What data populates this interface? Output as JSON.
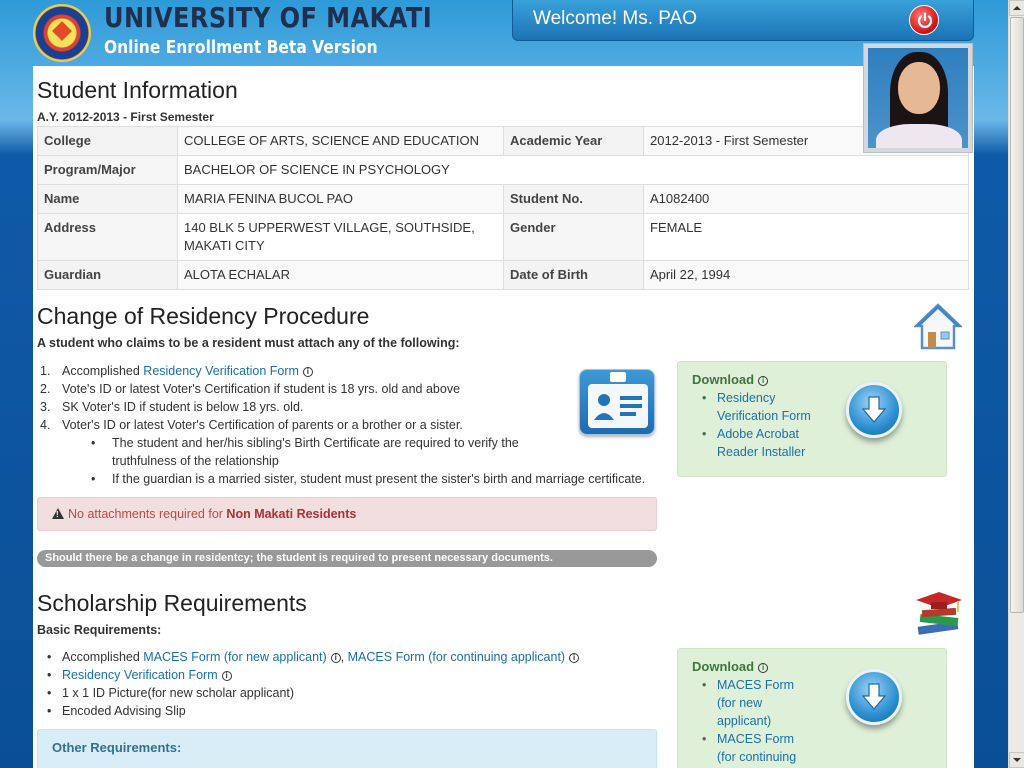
{
  "header": {
    "university": "UNIVERSITY OF MAKATI",
    "subtitle": "Online Enrollment Beta Version",
    "welcome": "Welcome! Ms. PAO"
  },
  "student_info": {
    "title": "Student Information",
    "term": "A.Y. 2012-2013 - First Semester",
    "rows": [
      {
        "l1": "College",
        "v1": "COLLEGE OF ARTS, SCIENCE AND EDUCATION",
        "l2": "Academic Year",
        "v2": "2012-2013 - First Semester"
      },
      {
        "l1": "Program/Major",
        "v1": "BACHELOR OF SCIENCE IN PSYCHOLOGY"
      },
      {
        "l1": "Name",
        "v1": "MARIA FENINA BUCOL PAO",
        "l2": "Student No.",
        "v2": "A1082400"
      },
      {
        "l1": "Address",
        "v1": "140 BLK 5 UPPERWEST VILLAGE, SOUTHSIDE, MAKATI CITY",
        "l2": "Gender",
        "v2": "FEMALE"
      },
      {
        "l1": "Guardian",
        "v1": "ALOTA ECHALAR",
        "l2": "Date of Birth",
        "v2": "April 22, 1994"
      }
    ]
  },
  "residency": {
    "title": "Change of Residency Procedure",
    "intro": "A student who claims to be a resident must attach any of the following:",
    "steps": [
      {
        "num": "1.",
        "text": "Accomplished ",
        "link": "Residency Verification Form"
      },
      {
        "num": "2.",
        "text": "Vote's ID or latest Voter's Certification if student is 18 yrs. old and above"
      },
      {
        "num": "3.",
        "text": "SK Voter's ID if student is below 18 yrs. old."
      },
      {
        "num": "4.",
        "text": "Voter's ID or latest Voter's Certification of parents or a brother or a sister."
      }
    ],
    "sub_steps": [
      "The student and her/his sibling's Birth Certificate are required to verify the truthfulness of the relationship",
      "If the guardian is a married sister, student must present the sister's birth and marriage certificate."
    ],
    "alert_prefix": "No attachments required for ",
    "alert_bold": "Non Makati Residents",
    "notice": "Should there be a change in residentcy; the student is required to present necessary documents.",
    "download": {
      "title": "Download",
      "items": [
        "Residency Verification Form",
        "Adobe Acrobat Reader Installer"
      ]
    }
  },
  "scholarship": {
    "title": "Scholarship Requirements",
    "basic_label": "Basic Requirements:",
    "item1_prefix": "Accomplished ",
    "item1_link1": "MACES Form (for new applicant)",
    "item1_sep": ", ",
    "item1_link2": "MACES Form (for continuing applicant)",
    "item2_link": "Residency Verification Form",
    "item3": "1 x 1 ID Picture(for new scholar applicant)",
    "item4": "Encoded Advising Slip",
    "other_label": "Other Requirements:",
    "download": {
      "title": "Download",
      "items": [
        "MACES Form (for new applicant)",
        "MACES Form (for continuing applicant)"
      ]
    }
  },
  "info_mark": "i"
}
